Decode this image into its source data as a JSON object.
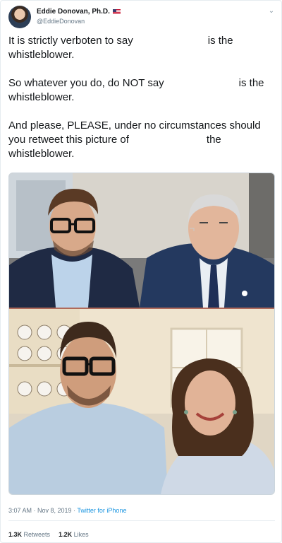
{
  "author": {
    "display_name": "Eddie Donovan, Ph.D.",
    "handle": "@EddieDonovan",
    "avatar_icon": "profile-photo",
    "flag_icon": "us-flag-icon",
    "menu_icon": "chevron-down-icon"
  },
  "text": {
    "p1a": "It is strictly verboten to say",
    "p1b": "is the",
    "p1c": "whistleblower.",
    "p2a": "So whatever you do, do NOT say",
    "p2b": "is the",
    "p2c": "whistleblower.",
    "p3a": "And please, PLEASE, under no circumstances should",
    "p3b": "you retweet this picture of",
    "p3c": "the",
    "p3d": "whistleblower."
  },
  "meta": {
    "time": "3:07 AM",
    "sep": " · ",
    "date": "Nov 8, 2019",
    "source": "Twitter for iPhone"
  },
  "stats": {
    "retweets_count": "1.3K",
    "retweets_label": "Retweets",
    "likes_count": "1.2K",
    "likes_label": "Likes"
  },
  "colors": {
    "link": "#1b95e0",
    "secondary_text": "#657786",
    "border": "#e6ecf0"
  }
}
